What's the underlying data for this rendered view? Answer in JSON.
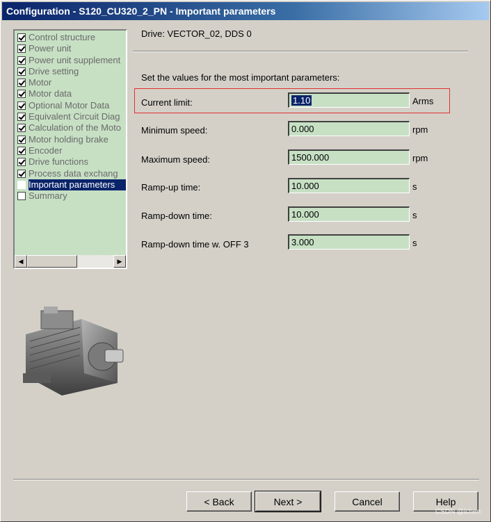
{
  "window": {
    "title": "Configuration - S120_CU320_2_PN - Important parameters"
  },
  "nav": {
    "items": [
      {
        "label": "Control structure",
        "checked": true,
        "selected": false
      },
      {
        "label": "Power unit",
        "checked": true,
        "selected": false
      },
      {
        "label": "Power unit supplement",
        "checked": true,
        "selected": false
      },
      {
        "label": "Drive setting",
        "checked": true,
        "selected": false
      },
      {
        "label": "Motor",
        "checked": true,
        "selected": false
      },
      {
        "label": "Motor data",
        "checked": true,
        "selected": false
      },
      {
        "label": "Optional Motor Data",
        "checked": true,
        "selected": false
      },
      {
        "label": "Equivalent Circuit Diag",
        "checked": true,
        "selected": false
      },
      {
        "label": "Calculation of the Moto",
        "checked": true,
        "selected": false
      },
      {
        "label": "Motor holding brake",
        "checked": true,
        "selected": false
      },
      {
        "label": "Encoder",
        "checked": true,
        "selected": false
      },
      {
        "label": "Drive functions",
        "checked": true,
        "selected": false
      },
      {
        "label": "Process data exchang",
        "checked": true,
        "selected": false
      },
      {
        "label": "Important parameters",
        "checked": false,
        "selected": true
      },
      {
        "label": "Summary",
        "checked": false,
        "selected": false
      }
    ]
  },
  "main": {
    "drive": "Drive: VECTOR_02, DDS 0",
    "instruction": "Set the values for the most important parameters:",
    "params": [
      {
        "label": "Current limit:",
        "value": "1.10",
        "unit": "Arms"
      },
      {
        "label": "Minimum speed:",
        "value": "0.000",
        "unit": "rpm"
      },
      {
        "label": "Maximum speed:",
        "value": "1500.000",
        "unit": "rpm"
      },
      {
        "label": "Ramp-up time:",
        "value": "10.000",
        "unit": "s"
      },
      {
        "label": "Ramp-down time:",
        "value": "10.000",
        "unit": "s"
      },
      {
        "label": "Ramp-down time w. OFF 3",
        "value": "3.000",
        "unit": "s"
      }
    ]
  },
  "buttons": {
    "back": "< Back",
    "next": "Next >",
    "cancel": "Cancel",
    "help": "Help"
  },
  "watermark": "CSDN @lchen",
  "colors": {
    "field_bg": "#c7e0c4",
    "selection": "#0a246a",
    "highlight_border": "#e03030"
  }
}
